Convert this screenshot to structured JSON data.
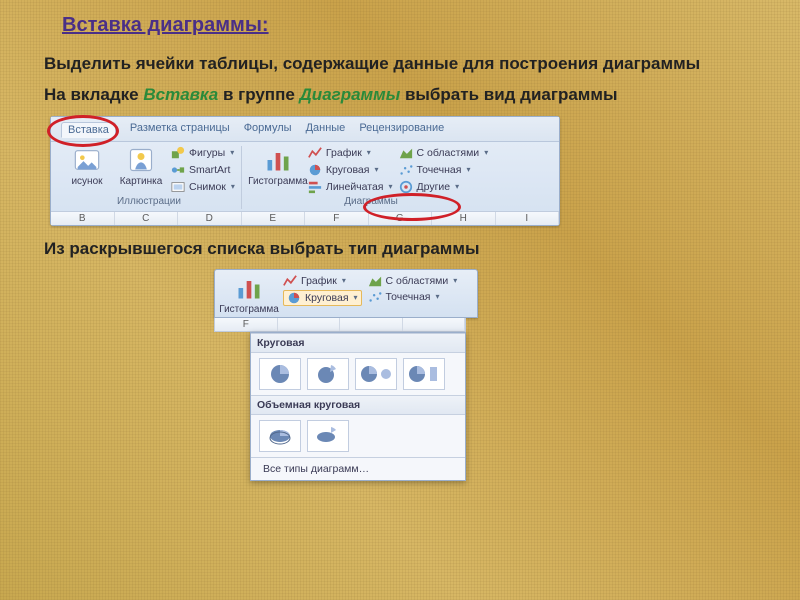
{
  "title": "Вставка диаграммы:",
  "p1": "Выделить ячейки таблицы, содержащие данные для построения диаграммы",
  "p2_a": "На вкладке ",
  "p2_kw1": "Вставка",
  "p2_b": " в группе ",
  "p2_kw2": "Диаграммы",
  "p2_c": " выбрать вид диаграммы",
  "p3": "Из раскрывшегося списка выбрать тип диаграммы",
  "ribbon": {
    "tabs": [
      "Вставка",
      "Разметка страницы",
      "Формулы",
      "Данные",
      "Рецензирование"
    ],
    "group_illustrations": {
      "label": "Иллюстрации",
      "btn_picture_file": "исунок",
      "btn_picture": "Картинка",
      "small": {
        "shapes": "Фигуры",
        "smartart": "SmartArt",
        "screenshot": "Снимок"
      }
    },
    "group_charts": {
      "label": "Диаграммы",
      "btn_histogram": "Гистограмма",
      "small": {
        "line": "График",
        "pie": "Круговая",
        "bar": "Линейчатая",
        "area": "С областями",
        "scatter": "Точечная",
        "other": "Другие"
      }
    },
    "columns": [
      "B",
      "C",
      "D",
      "E",
      "F",
      "G",
      "H",
      "I"
    ]
  },
  "dropdown": {
    "mini": {
      "btn_histogram": "Гистограмма",
      "line": "График",
      "pie_sel": "Круговая",
      "area": "С областями",
      "scatter": "Точечная"
    },
    "sec1": "Круговая",
    "sec2": "Объемная круговая",
    "all_icon": "⊞",
    "all": "Все типы диаграмм…",
    "cols": [
      "F",
      "",
      "",
      ""
    ]
  }
}
